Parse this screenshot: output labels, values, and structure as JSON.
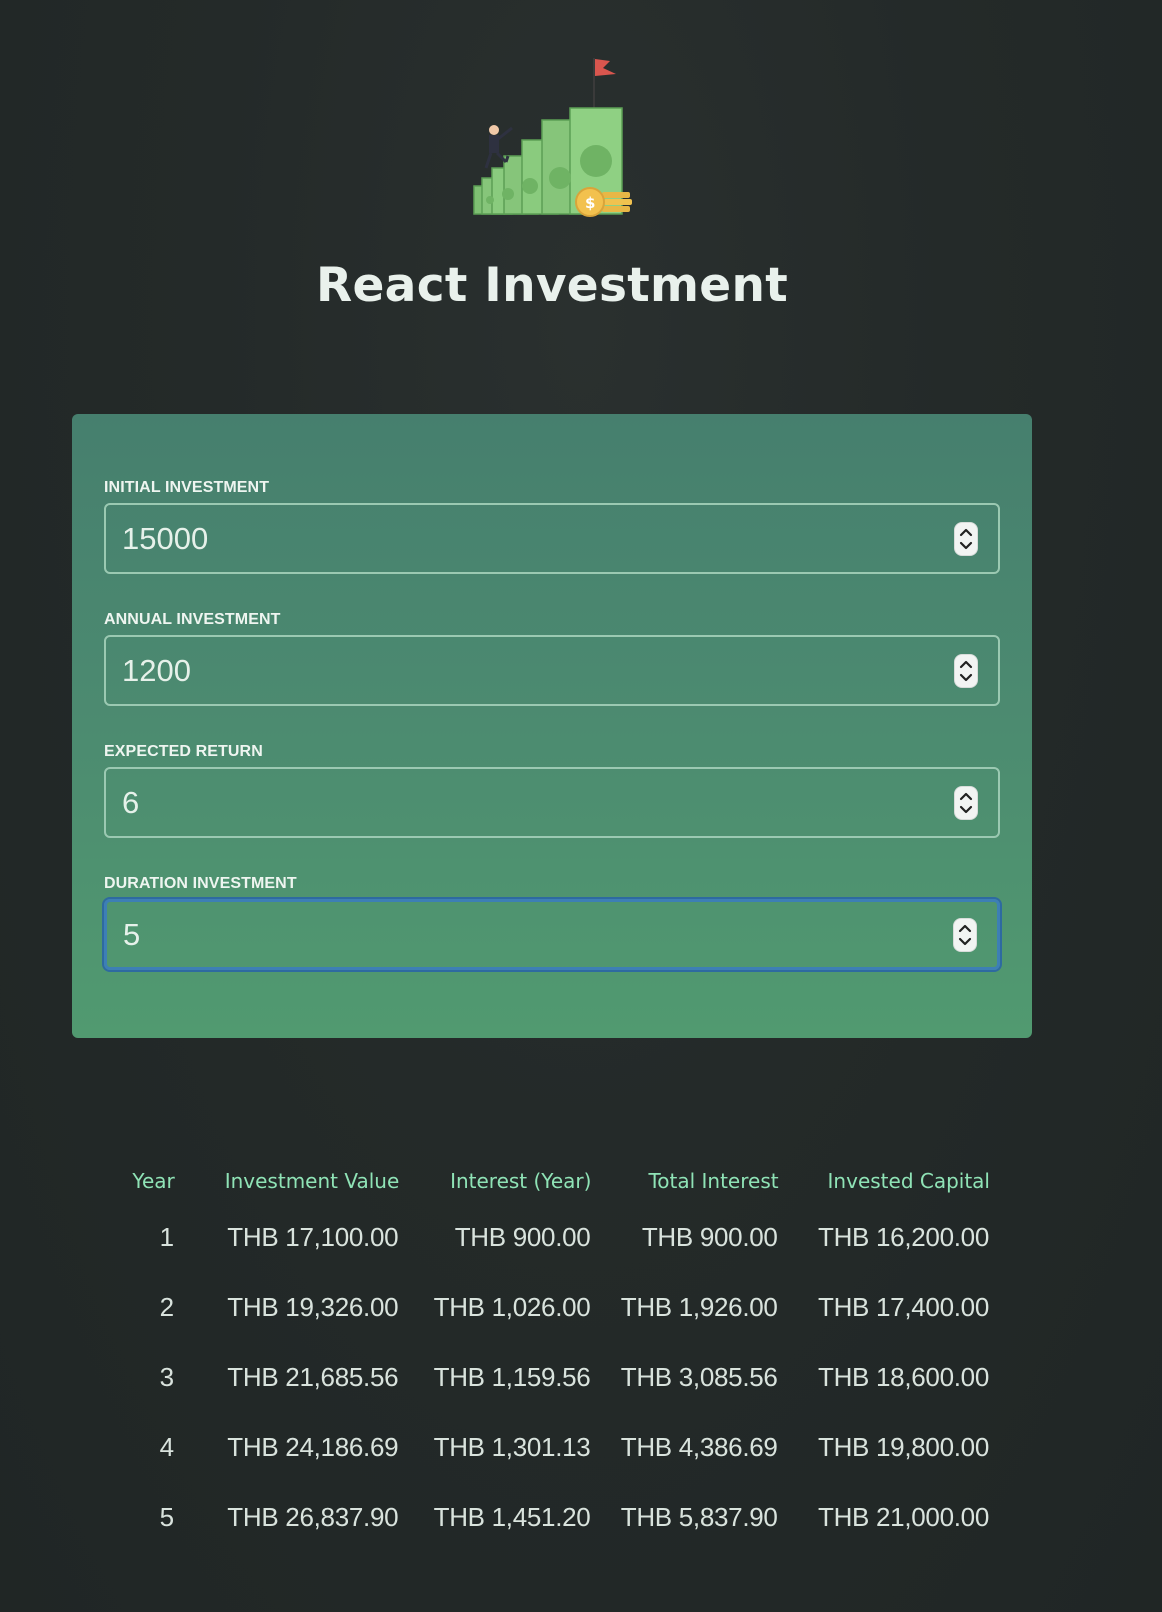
{
  "header": {
    "title": "React Investment",
    "logo_icon": "investment-stairs-logo"
  },
  "form": {
    "fields": [
      {
        "label": "INITIAL INVESTMENT",
        "value": "15000"
      },
      {
        "label": "ANNUAL INVESTMENT",
        "value": "1200"
      },
      {
        "label": "EXPECTED RETURN",
        "value": "6"
      },
      {
        "label": "DURATION INVESTMENT",
        "value": "5",
        "focused": true
      }
    ],
    "spinner_icon": "number-stepper-icon"
  },
  "results": {
    "columns": [
      "Year",
      "Investment Value",
      "Interest (Year)",
      "Total Interest",
      "Invested Capital"
    ],
    "rows": [
      [
        "1",
        "THB 17,100.00",
        "THB 900.00",
        "THB 900.00",
        "THB 16,200.00"
      ],
      [
        "2",
        "THB 19,326.00",
        "THB 1,026.00",
        "THB 1,926.00",
        "THB 17,400.00"
      ],
      [
        "3",
        "THB 21,685.56",
        "THB 1,159.56",
        "THB 3,085.56",
        "THB 18,600.00"
      ],
      [
        "4",
        "THB 24,186.69",
        "THB 1,301.13",
        "THB 4,386.69",
        "THB 19,800.00"
      ],
      [
        "5",
        "THB 26,837.90",
        "THB 1,451.20",
        "THB 5,837.90",
        "THB 21,000.00"
      ]
    ]
  },
  "colors": {
    "accent_header": "#8fe3b6",
    "focus_ring": "#3d7fb5",
    "panel_top": "#467f6e",
    "panel_bottom": "#519a70"
  }
}
